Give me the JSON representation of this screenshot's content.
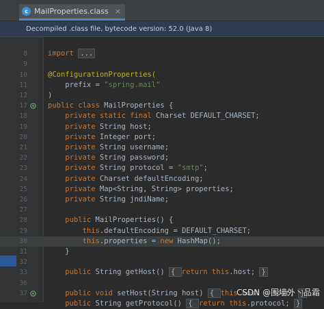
{
  "tab": {
    "icon": "class-file-icon",
    "icon_glyph": "c",
    "label": "MailProperties.class",
    "close_glyph": "×"
  },
  "notice": "Decompiled .class file, bytecode version: 52.0 (Java 8)",
  "lines": [
    {
      "num": "",
      "name": "blank-top"
    },
    {
      "num": "8"
    },
    {
      "num": "9"
    },
    {
      "num": "10"
    },
    {
      "num": "11"
    },
    {
      "num": "12"
    },
    {
      "num": "17",
      "gutter_icon": "bean-icon"
    },
    {
      "num": "18"
    },
    {
      "num": "19"
    },
    {
      "num": "20"
    },
    {
      "num": "21"
    },
    {
      "num": "22"
    },
    {
      "num": "23"
    },
    {
      "num": "24"
    },
    {
      "num": "25"
    },
    {
      "num": "26"
    },
    {
      "num": "27"
    },
    {
      "num": "28"
    },
    {
      "num": "29"
    },
    {
      "num": "30"
    },
    {
      "num": "31"
    },
    {
      "num": "32"
    },
    {
      "num": "33"
    },
    {
      "num": "36"
    },
    {
      "num": "37",
      "gutter_icon": "bean-icon"
    },
    {
      "num": ""
    }
  ],
  "code": {
    "l8": {
      "kw": "import",
      "fold": "..."
    },
    "l10": {
      "ann": "@ConfigurationProperties("
    },
    "l11": {
      "pre": "    prefix = ",
      "str": "\"spring.mail\""
    },
    "l12": {
      "text": ")"
    },
    "l17": {
      "kw": "public class",
      "rest": " MailProperties {"
    },
    "l18": {
      "kw": "    private static final",
      "rest": " Charset DEFAULT_CHARSET;"
    },
    "l19": {
      "kw": "    private",
      "rest": " String host;"
    },
    "l20": {
      "kw": "    private",
      "rest": " Integer port;"
    },
    "l21": {
      "kw": "    private",
      "rest": " String username;"
    },
    "l22": {
      "kw": "    private",
      "rest": " String password;"
    },
    "l23": {
      "kw": "    private",
      "rest": " String protocol = ",
      "str": "\"smtp\"",
      "end": ";"
    },
    "l24": {
      "kw": "    private",
      "rest": " Charset defaultEncoding;"
    },
    "l25": {
      "kw": "    private",
      "rest": " Map<String, String> properties;"
    },
    "l26": {
      "kw": "    private",
      "rest": " String jndiName;"
    },
    "l28": {
      "kw": "    public",
      "rest": " MailProperties() {"
    },
    "l29": {
      "kw": "        this",
      "rest": ".defaultEncoding = DEFAULT_CHARSET;"
    },
    "l30": {
      "kw": "        this",
      "rest": ".properties = ",
      "kw2": "new",
      "end": " HashMap();"
    },
    "l31": {
      "text": "    }"
    },
    "l33": {
      "kw": "    public",
      "rest": " String getHost() ",
      "fold1": "{ ",
      "kw2": "return this",
      "mid": ".host; ",
      "fold2": "}"
    },
    "l37": {
      "kw": "    public void",
      "rest": " setHost(String host) ",
      "fold1": "{ ",
      "kw2": "this",
      "mid": ".host = host; ",
      "fold2": "}"
    },
    "l38": {
      "kw": "    public",
      "rest": " String getProtocol() ",
      "fold1": "{ ",
      "kw2": "return this",
      "mid": ".protocol; ",
      "fold2": "}"
    }
  },
  "watermark": "CSDN @围墙外丶品霜",
  "colors": {
    "keyword": "#cc7832",
    "string": "#6a8759",
    "annotation": "#bbb529",
    "text": "#a9b7c6",
    "notice_bg": "#2d3c52"
  }
}
